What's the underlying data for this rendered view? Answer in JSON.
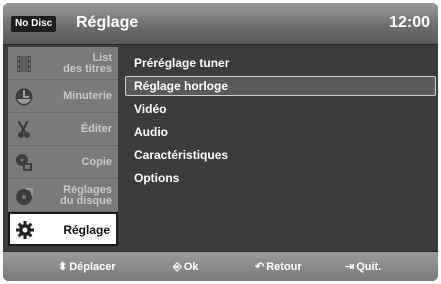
{
  "header": {
    "disc_status": "No Disc",
    "title": "Réglage",
    "clock": "12:00"
  },
  "sidebar": {
    "items": [
      {
        "label": "List\ndes titres",
        "icon": "film-icon",
        "active": false
      },
      {
        "label": "Minuterie",
        "icon": "timer-clock-icon",
        "active": false
      },
      {
        "label": "Éditer",
        "icon": "scissors-icon",
        "active": false
      },
      {
        "label": "Copie",
        "icon": "copy-icon",
        "active": false
      },
      {
        "label": "Réglages\ndu disque",
        "icon": "disc-settings-icon",
        "active": false
      },
      {
        "label": "Réglage",
        "icon": "gear-icon",
        "active": true
      }
    ]
  },
  "menu": {
    "items": [
      {
        "label": "Préréglage tuner",
        "selected": false
      },
      {
        "label": "Réglage horloge",
        "selected": true
      },
      {
        "label": "Vidéo",
        "selected": false
      },
      {
        "label": "Audio",
        "selected": false
      },
      {
        "label": "Caractéristiques",
        "selected": false
      },
      {
        "label": "Options",
        "selected": false
      }
    ]
  },
  "footer": {
    "move": {
      "glyph": "⬍",
      "label": "Déplacer",
      "icon": "up-down-arrows-icon"
    },
    "ok": {
      "glyph": "⎆",
      "label": "Ok",
      "icon": "enter-icon"
    },
    "back": {
      "glyph": "↶",
      "label": "Retour",
      "icon": "return-arrow-icon"
    },
    "quit": {
      "glyph": "⇥",
      "label": "Quit.",
      "icon": "exit-icon"
    }
  },
  "colors": {
    "header": "#6e6e6e",
    "background": "#3c3c3c",
    "sidebar_item": "#7a7a7a",
    "active_item": "#ffffff",
    "text": "#ffffff"
  }
}
